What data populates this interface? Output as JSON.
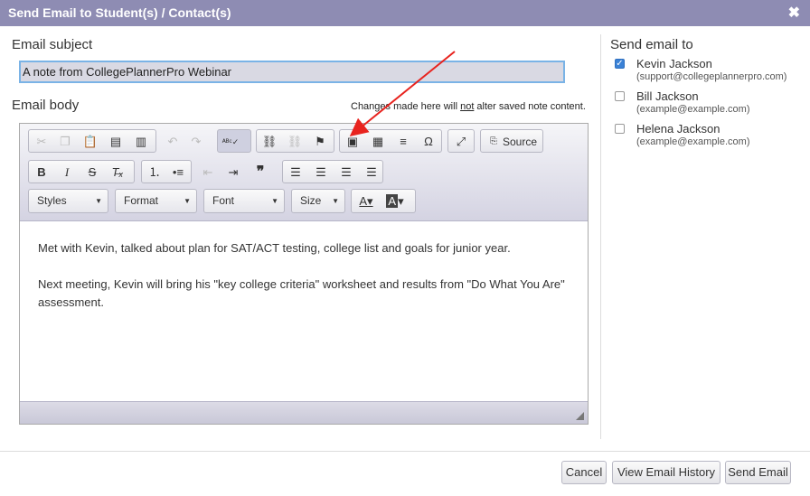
{
  "dialog": {
    "title": "Send Email to Student(s) / Contact(s)",
    "close_glyph": "✖"
  },
  "subject": {
    "label": "Email subject",
    "value": "A note from CollegePlannerPro Webinar"
  },
  "body": {
    "label": "Email body",
    "note_prefix": "Changes made here will ",
    "note_emph": "not",
    "note_suffix": " alter saved note content.",
    "paragraphs": [
      "Met with Kevin, talked about plan for SAT/ACT testing, college list and goals for junior year.",
      "Next meeting, Kevin will bring his \"key college criteria\" worksheet and results from \"Do What You Are\" assessment."
    ]
  },
  "toolbar": {
    "source_label": "Source",
    "styles_label": "Styles",
    "format_label": "Format",
    "font_label": "Font",
    "size_label": "Size",
    "icons_row1": [
      "cut-icon",
      "copy-icon",
      "paste-icon",
      "paste-text-icon",
      "paste-word-icon",
      "undo-icon",
      "redo-icon",
      "spellcheck-icon",
      "link-icon",
      "unlink-icon",
      "anchor-icon",
      "image-icon",
      "table-icon",
      "horizontal-rule-icon",
      "special-char-icon",
      "maximize-icon",
      "source-icon"
    ],
    "icons_row2": [
      "bold-icon",
      "italic-icon",
      "strike-icon",
      "remove-format-icon",
      "numbered-list-icon",
      "bullet-list-icon",
      "outdent-icon",
      "indent-icon",
      "blockquote-icon",
      "align-left-icon",
      "align-center-icon",
      "align-right-icon",
      "justify-icon"
    ]
  },
  "recipients": {
    "label": "Send email to",
    "items": [
      {
        "name": "Kevin Jackson",
        "email": "(support@collegeplannerpro.com)",
        "checked": true
      },
      {
        "name": "Bill Jackson",
        "email": "(example@example.com)",
        "checked": false
      },
      {
        "name": "Helena Jackson",
        "email": "(example@example.com)",
        "checked": false
      }
    ]
  },
  "footer": {
    "cancel": "Cancel",
    "history": "View Email History",
    "send": "Send Email"
  },
  "colors": {
    "titlebar": "#8e8cb3",
    "annotation_arrow": "#e8231e",
    "checkbox_on": "#3b82d6"
  }
}
